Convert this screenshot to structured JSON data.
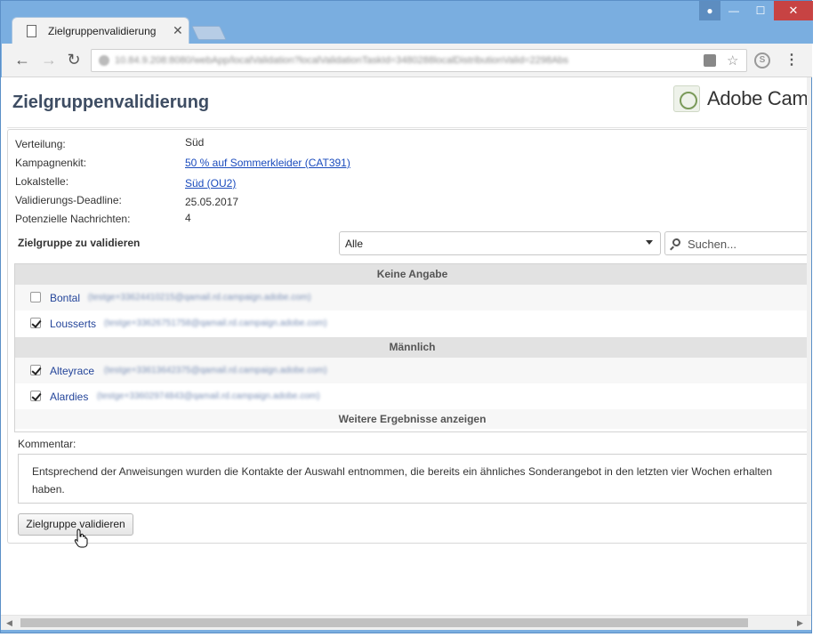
{
  "browser": {
    "tab_title": "Zielgruppenvalidierung",
    "url": "10.84.9.208:8080/webApp/localValidation?localValidationTaskId=3480288localDistributionValid=2298Abs"
  },
  "page": {
    "title": "Zielgruppenvalidierung",
    "logo_text": "Adobe Camp"
  },
  "info": [
    {
      "label": "Verteilung:",
      "value": "Süd",
      "link": false
    },
    {
      "label": "Kampagnenkit:",
      "value": "50 % auf Sommerkleider (CAT391)",
      "link": true
    },
    {
      "label": "Lokalstelle:",
      "value": "Süd (OU2)",
      "link": true
    },
    {
      "label": "Validierungs-Deadline:",
      "value": "25.05.2017",
      "link": false
    },
    {
      "label": "Potenzielle Nachrichten:",
      "value": "4",
      "link": false
    }
  ],
  "filter": {
    "label": "Zielgruppe zu validieren",
    "selected": "Alle",
    "search_placeholder": "Suchen..."
  },
  "groups": {
    "g1": "Keine Angabe",
    "g2": "Männlich"
  },
  "recipients": [
    {
      "name": "Bontal",
      "email": "(testge+33624410215@qamail.rd.campaign.adobe.com)",
      "checked": false
    },
    {
      "name": "Lousserts",
      "email": "(testge+33626751758@qamail.rd.campaign.adobe.com)",
      "checked": true
    },
    {
      "name": "Alteyrace",
      "email": "(testge+33613642375@qamail.rd.campaign.adobe.com)",
      "checked": true
    },
    {
      "name": "Alardies",
      "email": "(testge+33602974843@qamail.rd.campaign.adobe.com)",
      "checked": true
    }
  ],
  "more_results": "Weitere Ergebnisse anzeigen",
  "comment": {
    "label": "Kommentar:",
    "text": "Entsprechend der Anweisungen wurden die Kontakte der Auswahl entnommen, die bereits ein ähnliches Sonderangebot in den letzten vier Wochen erhalten haben."
  },
  "actions": {
    "validate_label": "Zielgruppe validieren"
  }
}
